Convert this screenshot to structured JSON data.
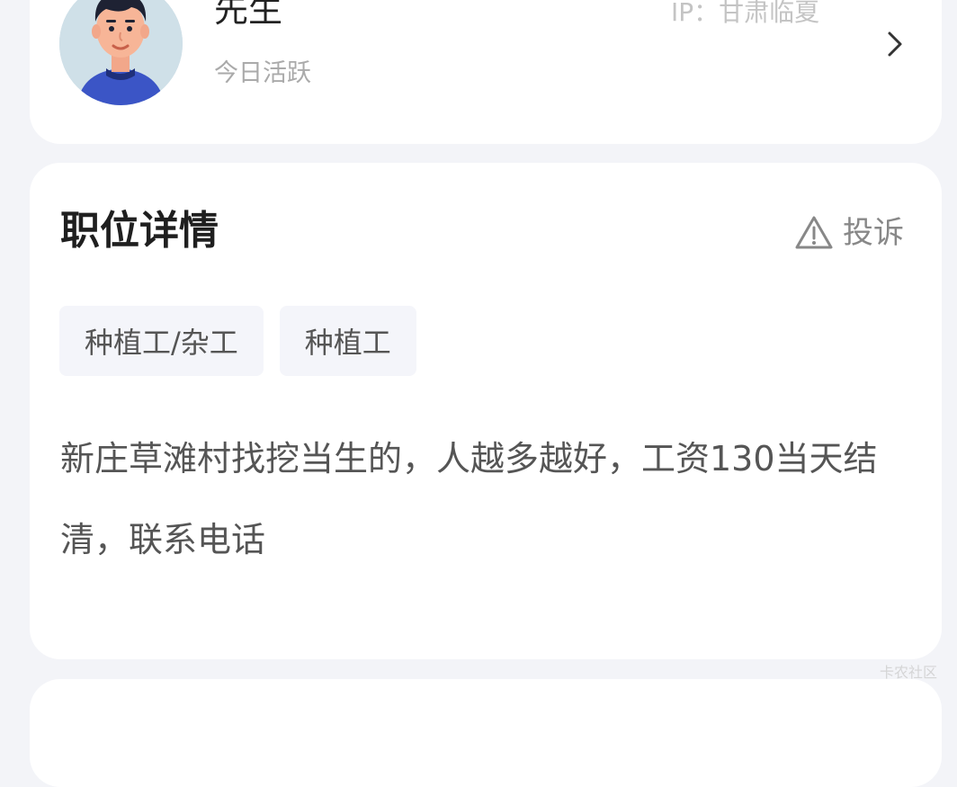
{
  "publisher": {
    "name": "先生",
    "status": "今日活跃",
    "ip_label": "IP：甘肃临夏"
  },
  "job_detail": {
    "title": "职位详情",
    "report_label": "投诉",
    "tags": [
      "种植工/杂工",
      "种植工"
    ],
    "description": "新庄草滩村找挖当生的，人越多越好，工资130当天结清，联系电话"
  },
  "watermark": "卡农社区",
  "colors": {
    "page_bg": "#f3f4f8",
    "card_bg": "#ffffff",
    "tag_bg": "#f4f5fa",
    "muted_text": "#888888"
  },
  "icons": {
    "report": "warning-triangle-icon",
    "chevron": "chevron-right-icon"
  }
}
